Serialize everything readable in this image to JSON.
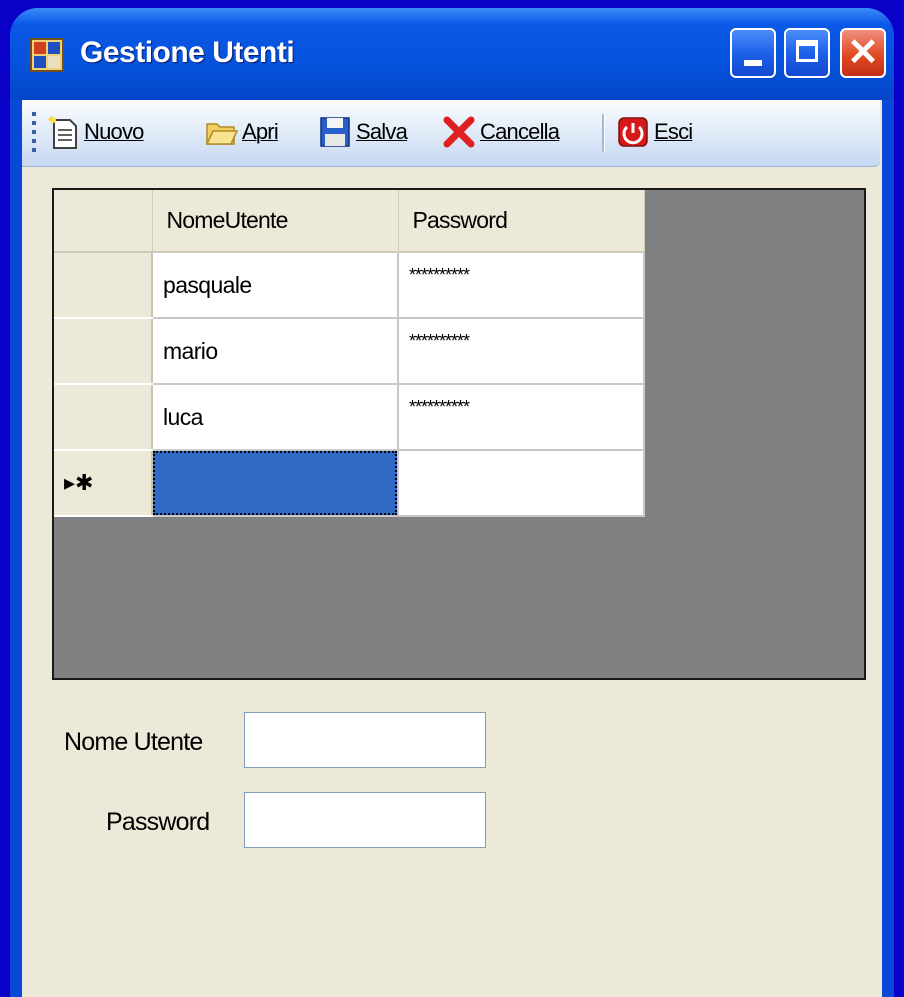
{
  "window": {
    "title": "Gestione Utenti"
  },
  "toolbar": {
    "nuovo": "Nuovo",
    "apri": "Apri",
    "salva": "Salva",
    "cancella": "Cancella",
    "esci": "Esci"
  },
  "grid": {
    "columns": [
      "NomeUtente",
      "Password"
    ],
    "rows": [
      {
        "nome": "pasquale",
        "password": "**********"
      },
      {
        "nome": "mario",
        "password": "**********"
      },
      {
        "nome": "luca",
        "password": "**********"
      }
    ],
    "new_row_marker": "▸✱",
    "selection_color": "#316ac5"
  },
  "form": {
    "nome_utente_label": "Nome Utente",
    "nome_utente_value": "",
    "password_label": "Password",
    "password_value": ""
  },
  "icons": {
    "app": "app-window-icon",
    "nuovo": "new-document-icon",
    "apri": "open-folder-icon",
    "salva": "save-disk-icon",
    "cancella": "delete-x-icon",
    "esci": "power-exit-icon"
  }
}
